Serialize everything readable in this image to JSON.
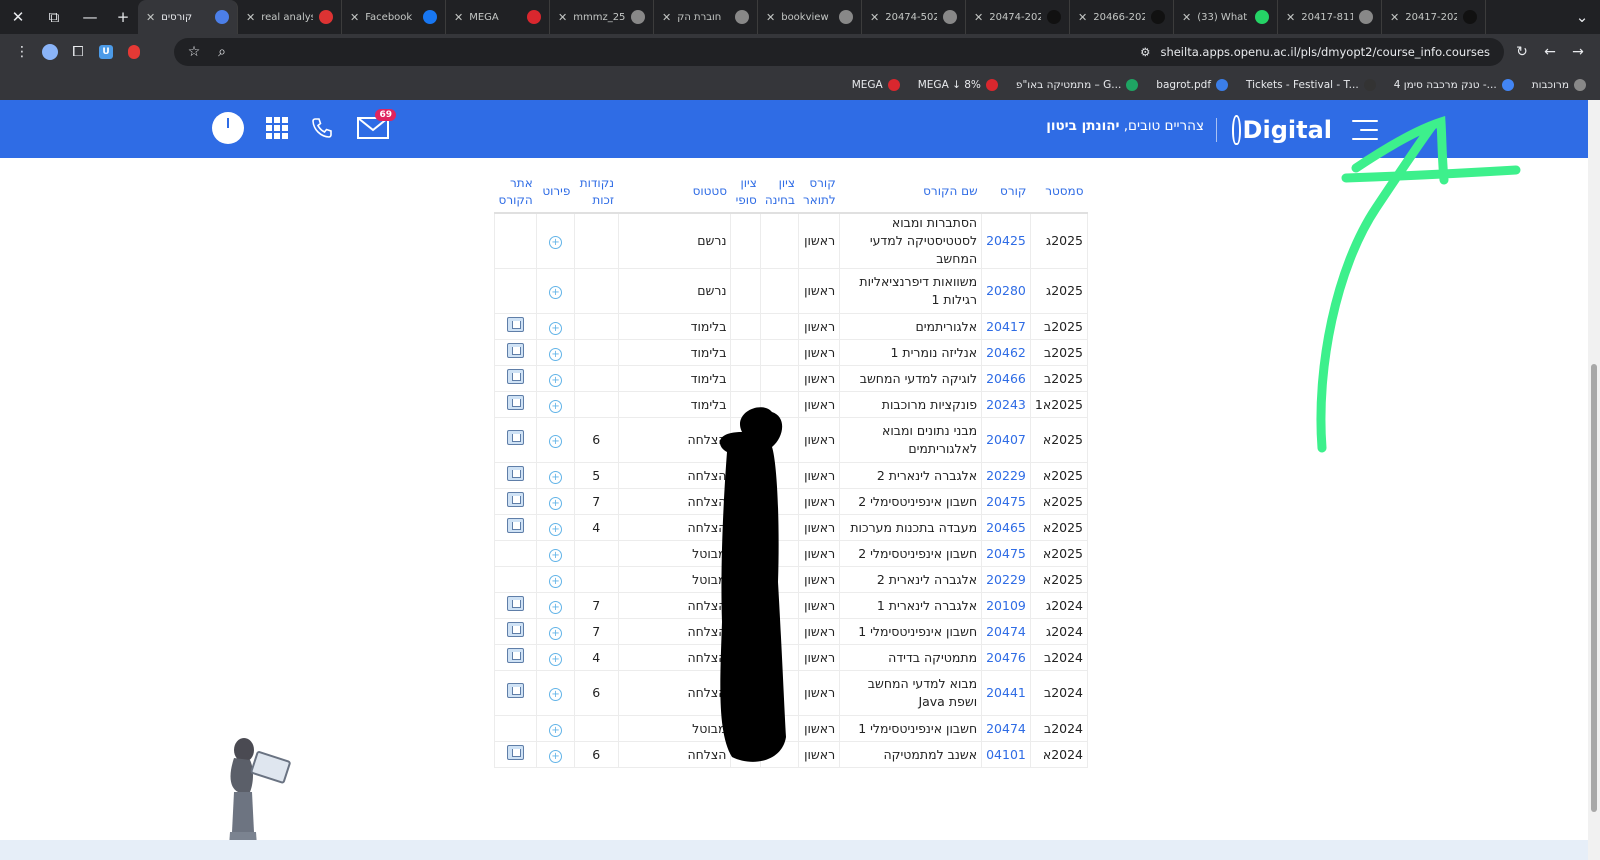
{
  "browser": {
    "tabs": [
      {
        "title": "קורסים",
        "active": true
      },
      {
        "title": "real analys",
        "active": false
      },
      {
        "title": "Facebook",
        "active": false
      },
      {
        "title": "MEGA",
        "active": false
      },
      {
        "title": "mmmz_25",
        "active": false
      },
      {
        "title": "חוברת הק",
        "active": false
      },
      {
        "title": "bookview",
        "active": false
      },
      {
        "title": "20474-502",
        "active": false
      },
      {
        "title": "20474-202",
        "active": false
      },
      {
        "title": "20466-202",
        "active": false
      },
      {
        "title": "(33) What",
        "active": false
      },
      {
        "title": "20417-811",
        "active": false
      },
      {
        "title": "20417-202",
        "active": false
      }
    ],
    "url": "sheilta.apps.openu.ac.il/pls/dmyopt2/course_info.courses",
    "bookmarks": [
      "מרוכבות",
      "טנק מרכבה סימן 4 -...",
      "Tickets - Festival - T...",
      "bagrot.pdf",
      "מתמטיקה באו\"פ – G...",
      "MEGA ↓ 8%",
      "MEGA"
    ]
  },
  "header": {
    "greeting": "צהריים טובים,",
    "user_name": "יהונתן ביטון",
    "logo_text": "Digital",
    "mail_count": "69"
  },
  "table": {
    "columns": [
      "סמסטר",
      "קורס",
      "שם הקורס",
      "קורס לתואר",
      "ציון בחינה",
      "ציון סופי",
      "סטטוס",
      "נקודות זכות",
      "פירוט",
      "אתר הקורס"
    ],
    "rows": [
      {
        "semester": "2025ג",
        "code": "20425",
        "name": "הסתברות ומבוא לסטטיסטיקה למדעי המחשב",
        "degree": "ראשון",
        "exam": "",
        "final": "",
        "status": "נרשם",
        "credits": "",
        "site": false,
        "tall": true
      },
      {
        "semester": "2025ג",
        "code": "20280",
        "name": "משוואות דיפרנציאליות רגילות 1",
        "degree": "ראשון",
        "exam": "",
        "final": "",
        "status": "נרשם",
        "credits": "",
        "site": false,
        "tall": true
      },
      {
        "semester": "2025ב",
        "code": "20417",
        "name": "אלגוריתמים",
        "degree": "ראשון",
        "exam": "",
        "final": "",
        "status": "בלימוד",
        "credits": "",
        "site": true,
        "tall": false
      },
      {
        "semester": "2025ב",
        "code": "20462",
        "name": "אנליזה נומרית 1",
        "degree": "ראשון",
        "exam": "",
        "final": "",
        "status": "בלימוד",
        "credits": "",
        "site": true,
        "tall": false
      },
      {
        "semester": "2025ב",
        "code": "20466",
        "name": "לוגיקה למדעי המחשב",
        "degree": "ראשון",
        "exam": "",
        "final": "",
        "status": "בלימוד",
        "credits": "",
        "site": true,
        "tall": false
      },
      {
        "semester": "2025א1",
        "code": "20243",
        "name": "פונקציות מרוכבות",
        "degree": "ראשון",
        "exam": "",
        "final": "",
        "status": "בלימוד",
        "credits": "",
        "site": true,
        "tall": false
      },
      {
        "semester": "2025א",
        "code": "20407",
        "name": "מבני נתונים ומבוא לאלגוריתמים",
        "degree": "ראשון",
        "exam": "",
        "final": "",
        "status": "הצלחה",
        "credits": "6",
        "site": true,
        "tall": true
      },
      {
        "semester": "2025א",
        "code": "20229",
        "name": "אלגברה לינארית 2",
        "degree": "ראשון",
        "exam": "",
        "final": "",
        "status": "הצלחה",
        "credits": "5",
        "site": true,
        "tall": false
      },
      {
        "semester": "2025א",
        "code": "20475",
        "name": "חשבון אינפיניטסימלי 2",
        "degree": "ראשון",
        "exam": "",
        "final": "",
        "status": "הצלחה",
        "credits": "7",
        "site": true,
        "tall": false
      },
      {
        "semester": "2025א",
        "code": "20465",
        "name": "מעבדה בתכנות מערכות",
        "degree": "ראשון",
        "exam": "",
        "final": "",
        "status": "הצלחה",
        "credits": "4",
        "site": true,
        "tall": false
      },
      {
        "semester": "2025א",
        "code": "20475",
        "name": "חשבון אינפיניטסימלי 2",
        "degree": "ראשון",
        "exam": "",
        "final": "",
        "status": "מבוטל",
        "credits": "",
        "site": false,
        "tall": false
      },
      {
        "semester": "2025א",
        "code": "20229",
        "name": "אלגברה לינארית 2",
        "degree": "ראשון",
        "exam": "",
        "final": "",
        "status": "מבוטל",
        "credits": "",
        "site": false,
        "tall": false
      },
      {
        "semester": "2024ג",
        "code": "20109",
        "name": "אלגברה לינארית 1",
        "degree": "ראשון",
        "exam": "",
        "final": "",
        "status": "הצלחה",
        "credits": "7",
        "site": true,
        "tall": false
      },
      {
        "semester": "2024ג",
        "code": "20474",
        "name": "חשבון אינפיניטסימלי 1",
        "degree": "ראשון",
        "exam": "",
        "final": "",
        "status": "הצלחה",
        "credits": "7",
        "site": true,
        "tall": false
      },
      {
        "semester": "2024ב",
        "code": "20476",
        "name": "מתמטיקה בדידה",
        "degree": "ראשון",
        "exam": "",
        "final": "",
        "status": "הצלחה",
        "credits": "4",
        "site": true,
        "tall": false
      },
      {
        "semester": "2024ב",
        "code": "20441",
        "name": "מבוא למדעי המחשב ושפת Java",
        "degree": "ראשון",
        "exam": "",
        "final": "",
        "status": "הצלחה",
        "credits": "6",
        "site": true,
        "tall": true
      },
      {
        "semester": "2024ב",
        "code": "20474",
        "name": "חשבון אינפיניטסימלי 1",
        "degree": "ראשון",
        "exam": "",
        "final": "",
        "status": "מבוטל",
        "credits": "",
        "site": false,
        "tall": false
      },
      {
        "semester": "2024א",
        "code": "04101",
        "name": "אשנב למתמטיקה",
        "degree": "ראשון",
        "exam": "",
        "final": "",
        "status": "הצלחה",
        "credits": "6",
        "site": true,
        "tall": false
      }
    ]
  }
}
